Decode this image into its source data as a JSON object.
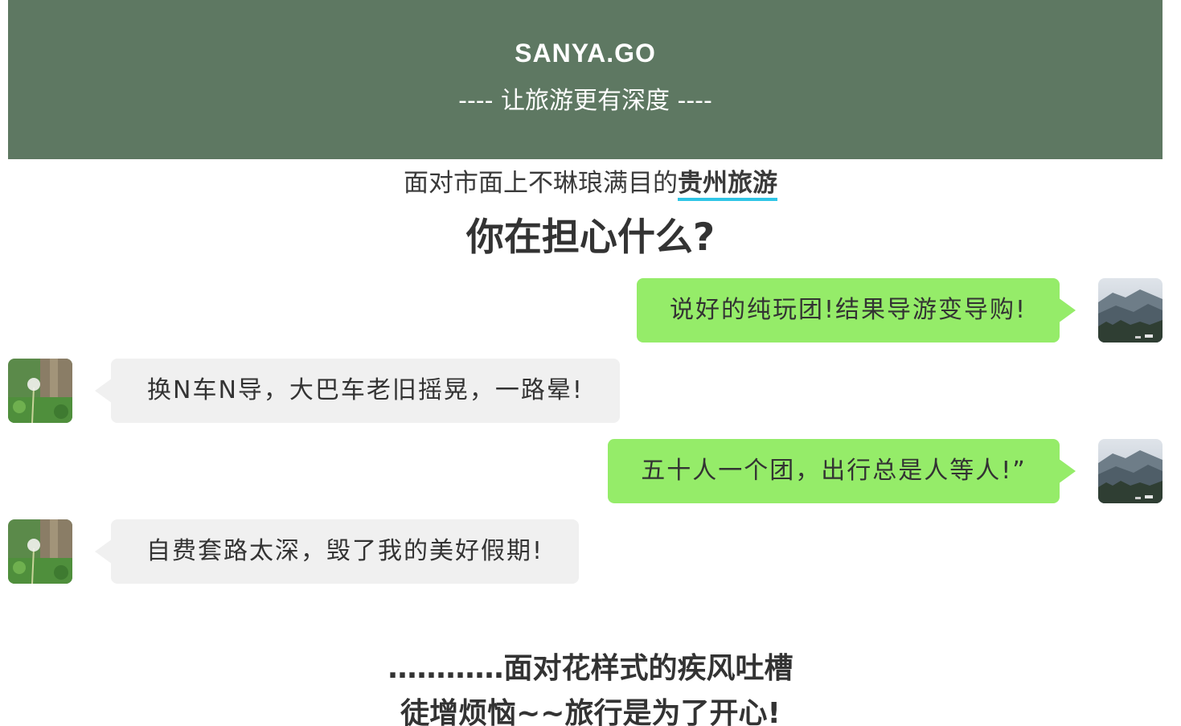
{
  "banner": {
    "brand": "SANYA.GO",
    "slogan": "---- 让旅游更有深度 ----",
    "background_color": "#5e7862"
  },
  "intro": {
    "prefix": "面对市面上不琳琅满目的",
    "highlight": "贵州旅游",
    "highlight_underline_color": "#2fc5e6"
  },
  "headline": "你在担心什么?",
  "chat": [
    {
      "side": "right",
      "avatar": "mountain-avatar-icon",
      "text": "说好的纯玩团!结果导游变导购!"
    },
    {
      "side": "left",
      "avatar": "dandelion-avatar-icon",
      "text": "换N车N导，大巴车老旧摇晃，一路晕!"
    },
    {
      "side": "right",
      "avatar": "mountain-avatar-icon",
      "text": "五十人一个团，出行总是人等人!”"
    },
    {
      "side": "left",
      "avatar": "dandelion-avatar-icon",
      "text": "自费套路太深，毁了我的美好假期!"
    }
  ],
  "bubble_colors": {
    "right": "#95ec69",
    "left": "#f0f0f0"
  },
  "closing": {
    "line1": "…………面对花样式的疾风吐槽",
    "line2": "徒增烦恼~~旅行是为了开心!"
  }
}
